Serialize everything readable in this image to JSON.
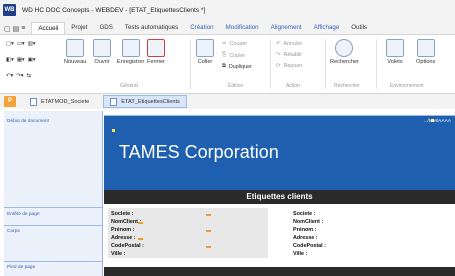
{
  "window": {
    "logo": "WB",
    "title": "WD HC DOC Concepts - WEBDEV - [ETAT_EtiquettesClients *]"
  },
  "menu": {
    "tabs": [
      {
        "label": "Accueil",
        "active": true
      },
      {
        "label": "Projet"
      },
      {
        "label": "GDS"
      },
      {
        "label": "Tests automatiques"
      },
      {
        "label": "Création",
        "blue": true
      },
      {
        "label": "Modification",
        "blue": true
      },
      {
        "label": "Alignement",
        "blue": true
      },
      {
        "label": "Affichage",
        "blue": true
      },
      {
        "label": "Outils"
      }
    ]
  },
  "ribbon": {
    "nouveau": "Nouveau",
    "ouvrir": "Ouvrir",
    "enregistrer": "Enregistrer",
    "fermer": "Fermer",
    "coller": "Coller",
    "couper": "Couper",
    "copier": "Copier",
    "dupliquer": "Dupliquer",
    "annuler": "Annuler",
    "retablir": "Rétablir",
    "rejouer": "Rejouer",
    "rechercher": "Rechercher",
    "volets": "Volets",
    "options": "Options",
    "group_general": "Général",
    "group_edition": "Édition",
    "group_action": "Action",
    "group_rechercher": "Rechercher",
    "group_environnement": "Environnement"
  },
  "doc_tabs": {
    "pin": "P",
    "tab1": "ETATMOD_Societe",
    "tab2": "ETAT_EtiquettesClients"
  },
  "bands": {
    "debut": "Début de document",
    "entete": "Entête de page",
    "corps": "Corps",
    "pied": "Pied de page"
  },
  "report": {
    "date": ".../MM/AAAA",
    "company": "TAMES Corporation",
    "subtitle": "Etiquettes clients",
    "fields": [
      "Societe :",
      "NomClient :",
      "Prénom :",
      "Adresse :",
      "CodePostal :",
      "Ville :"
    ]
  }
}
